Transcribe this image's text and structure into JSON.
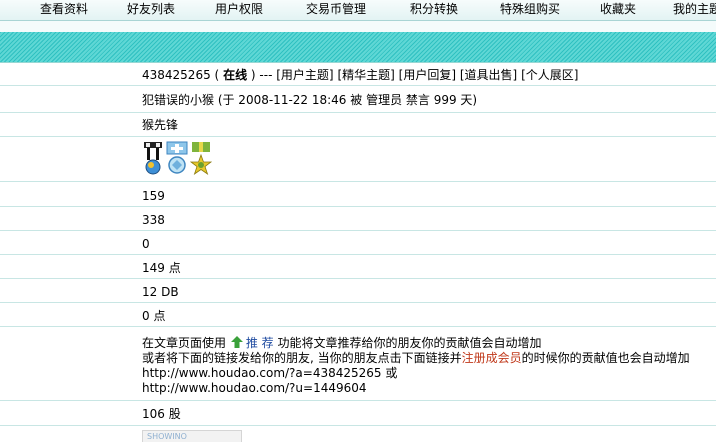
{
  "nav": {
    "items": [
      "查看资料",
      "好友列表",
      "用户权限",
      "交易币管理",
      "积分转换",
      "特殊组购买",
      "收藏夹",
      "我的主题"
    ]
  },
  "profile": {
    "username": "438425265",
    "open_paren": "(",
    "status": "在线",
    "close_paren": ")",
    "separator": "---",
    "links": [
      "[用户主题]",
      "[精华主题]",
      "[用户回复]",
      "[道具出售]",
      "[个人展区]"
    ],
    "ban_note": "犯错误的小猴 (于 2008-11-22 18:46 被 管理员 禁言 999 天)",
    "rank": "猴先锋",
    "medals": [
      "medal-ti-icon",
      "medal-cross-icon",
      "medal-star-icon"
    ],
    "stat1": "159",
    "stat2": "338",
    "stat3": "0",
    "points": "149 点",
    "db": "12 DB",
    "zero_points": "0 点",
    "promo": {
      "line1_prefix": "在文章页面使用",
      "recommend_label": "推 荐",
      "line1_suffix": "功能将文章推荐给你的朋友你的贡献值会自动增加",
      "line2_prefix": "或者将下面的链接发给你的朋友, 当你的朋友点击下面链接并",
      "register_link": "注册成会员",
      "line2_suffix": "的时候你的贡献值也会自动增加",
      "url1": "http://www.houdao.com/?a=438425265",
      "url1_or": "或",
      "url2": "http://www.houdao.com/?u=1449604"
    },
    "shares": "106 股",
    "banner_text": "SHOWINO"
  },
  "colors": {
    "band": "#3cc8c6",
    "row_border": "#c8e6e4",
    "register_link": "#c0391b",
    "recommend": "#1e4aa0"
  }
}
